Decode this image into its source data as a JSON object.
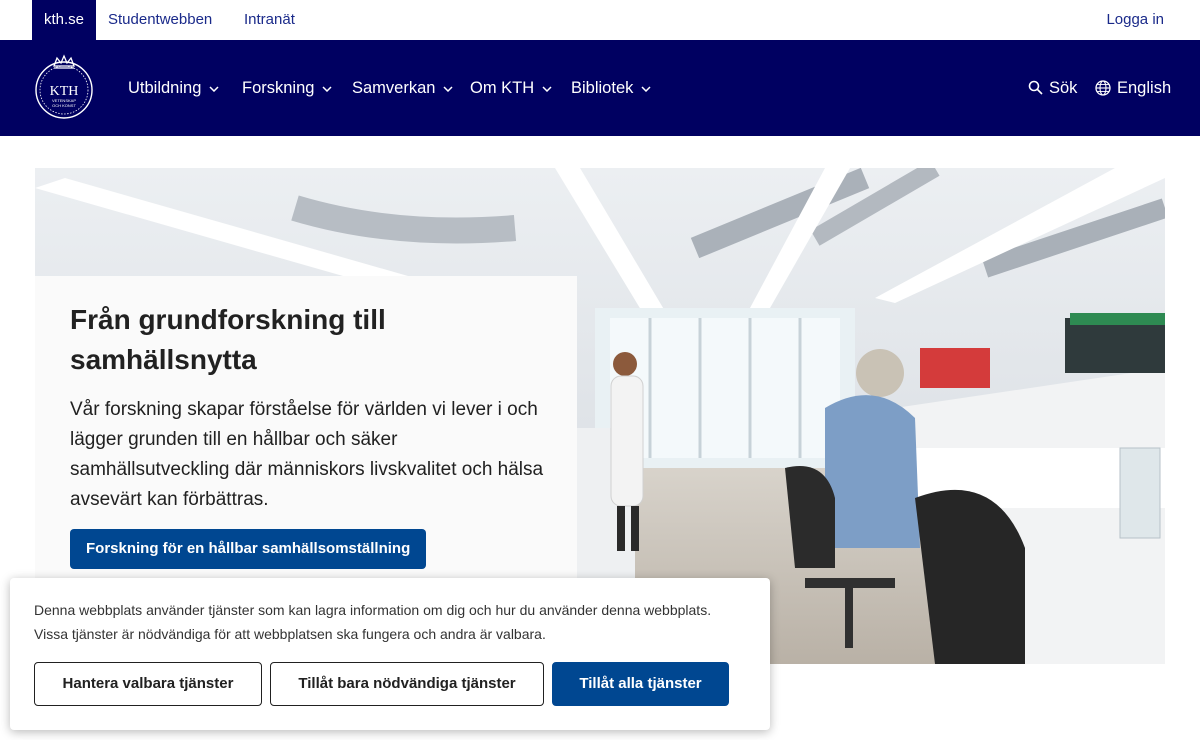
{
  "topbar": {
    "site_label": "kth.se",
    "student_label": "Studentwebben",
    "intranet_label": "Intranät",
    "login_label": "Logga in"
  },
  "header": {
    "logo_text": "KTH",
    "logo_subtext_1": "VETENSKAP",
    "logo_subtext_2": "OCH KONST",
    "nav": [
      {
        "label": "Utbildning"
      },
      {
        "label": "Forskning"
      },
      {
        "label": "Samverkan"
      },
      {
        "label": "Om KTH"
      },
      {
        "label": "Bibliotek"
      }
    ],
    "search_label": "Sök",
    "language_label": "English"
  },
  "hero": {
    "title": "Från grundforskning till samhällsnytta",
    "text": "Vår forskning skapar förståelse för världen vi lever i och lägger grunden till en hållbar och säker samhällsutveckling där människors livskvalitet och hälsa avsevärt kan förbättras.",
    "button_label": "Forskning för en hållbar samhällsomställning"
  },
  "cookie": {
    "text": "Denna webbplats använder tjänster som kan lagra information om dig och hur du använder denna webbplats. Vissa tjänster är nödvändiga för att webbplatsen ska fungera och andra är valbara.",
    "manage_label": "Hantera valbara tjänster",
    "necessary_label": "Tillåt bara nödvändiga tjänster",
    "allow_all_label": "Tillåt alla tjänster"
  },
  "colors": {
    "brand_navy": "#000061",
    "button_blue": "#004791"
  }
}
